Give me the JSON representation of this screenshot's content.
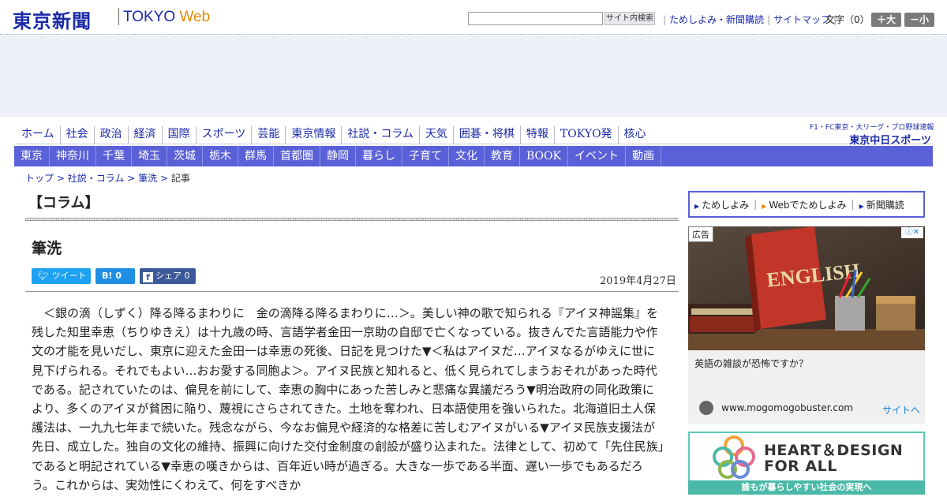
{
  "header": {
    "logo_jp": "東京新聞",
    "logo_en_main": "TOKYO",
    "logo_en_web": "Web",
    "search_button": "サイト内検索",
    "links": [
      "ためしよみ・新聞購読",
      "サイトマップ"
    ],
    "font_size_label": "文字（0）",
    "font_large": "＋大",
    "font_small": "－小"
  },
  "nav_primary": [
    "ホーム",
    "社会",
    "政治",
    "経済",
    "国際",
    "スポーツ",
    "芸能",
    "東京情報",
    "社説・コラム",
    "天気",
    "囲碁・将棋",
    "特報",
    "TOKYO発",
    "核心"
  ],
  "chunichi": {
    "tagline": "F1・FC東京・大リーグ・プロ野球速報",
    "name": "東京中日スポーツ"
  },
  "nav_secondary": [
    "東京",
    "神奈川",
    "千葉",
    "埼玉",
    "茨城",
    "栃木",
    "群馬",
    "首都圏",
    "静岡",
    "暮らし",
    "子育て",
    "文化",
    "教育",
    "BOOK",
    "イベント",
    "動画"
  ],
  "breadcrumb": {
    "top": "トップ",
    "section": "社説・コラム",
    "column": "筆洗",
    "current": "記事"
  },
  "article": {
    "category": "【コラム】",
    "title": "筆洗",
    "date": "2019年4月27日",
    "share_twitter": "ツイート",
    "share_hatena": "B! 0",
    "share_facebook": "シェア 0",
    "body": "＜銀の滴（しずく）降る降るまわりに　金の滴降る降るまわりに…＞。美しい神の歌で知られる『アイヌ神謡集』を残した知里幸恵（ちりゆきえ）は十九歳の時、言語学者金田一京助の自邸で亡くなっている。抜きんでた言語能力や作文の才能を見いだし、東京に迎えた金田一は幸恵の死後、日記を見つけた▼＜私はアイヌだ…アイヌなるがゆえに世に見下げられる。それでもよい…おお愛する同胞よ＞。アイヌ民族と知れると、低く見られてしまうおそれがあった時代である。記されていたのは、偏見を前にして、幸恵の胸中にあった苦しみと悲痛な異議だろう▼明治政府の同化政策により、多くのアイヌが貧困に陥り、蔑視にさらされてきた。土地を奪われ、日本語使用を強いられた。北海道旧土人保護法は、一九九七年まで続いた。残念ながら、今なお偏見や経済的な格差に苦しむアイヌがいる▼アイヌ民族支援法が先日、成立した。独自の文化の維持、振興に向けた交付金制度の創設が盛り込まれた。法律として、初めて「先住民族」であると明記されている▼幸恵の嘆きからは、百年近い時が過ぎる。大きな一歩である半面、遅い一歩でもあるだろう。これからは、実効性にくわえて、何をすべきか"
  },
  "sidebar": {
    "sub_links": [
      "ためしよみ",
      "Webでためしよみ",
      "新聞購読"
    ],
    "ad": {
      "label": "広告",
      "book_title": "ENGLISH",
      "headline": "英語の雑談が恐怖ですか？",
      "domain": "www.mogomogobuster.com",
      "cta": "サイトへ"
    },
    "banner": {
      "line1": "HEART＆DESIGN",
      "line2": "FOR ALL",
      "footer": "誰もが暮らしやすい社会の実現へ"
    }
  },
  "colors": {
    "brand_blue": "#1a2aa8",
    "nav_bar": "#5a60d8",
    "web_orange": "#e68a00",
    "twitter": "#1da1f2",
    "hatena": "#1f8fe6",
    "facebook": "#3b5998",
    "banner_teal": "#4bb9a8"
  }
}
